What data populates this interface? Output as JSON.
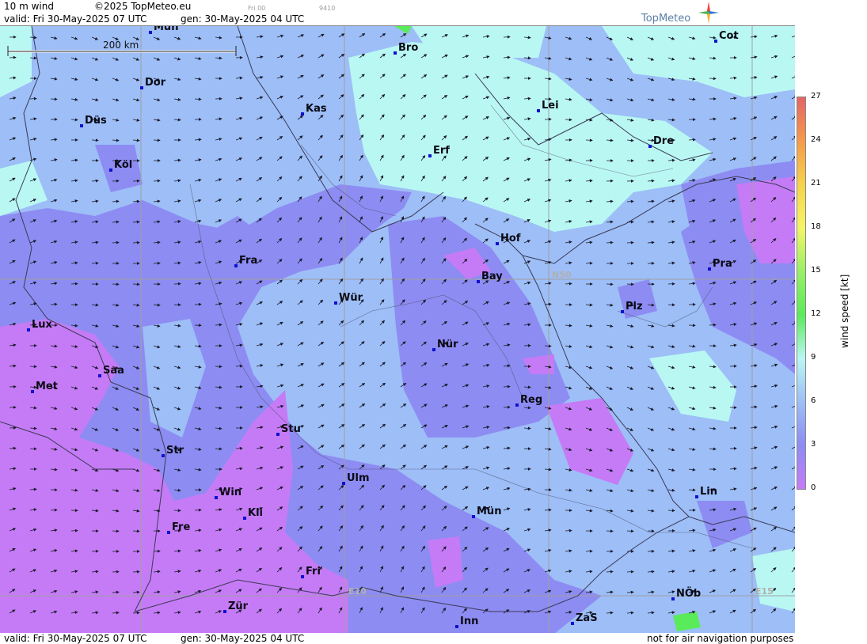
{
  "header": {
    "field": "10 m wind",
    "copyright": "©2025 TopMeteo.eu",
    "small_time": "Fri 00",
    "small_code": "9410",
    "valid": "valid:  Fri  30-May-2025  07 UTC",
    "gen": "gen: 30-May-2025 04 UTC",
    "logo": "TopMeteo"
  },
  "footer": {
    "valid": "valid:  Fri  30-May-2025  07 UTC",
    "gen": "gen: 30-May-2025 04 UTC",
    "disclaimer": "not for air navigation purposes"
  },
  "scale_bar": "200 km",
  "grid_labels": [
    "N50",
    "E10",
    "E15"
  ],
  "cities": [
    "Mün",
    "Bro",
    "Cot",
    "Dor",
    "Kas",
    "Lei",
    "Düs",
    "Erf",
    "Dre",
    "Köl",
    "Hof",
    "Pra",
    "Fra",
    "Bay",
    "Wür",
    "Plz",
    "Lux",
    "Nür",
    "Saa",
    "Met",
    "Reg",
    "Stu",
    "Str",
    "Ulm",
    "Lin",
    "Win",
    "Kli",
    "Mün",
    "Fre",
    "Fri",
    "NÖb",
    "Zür",
    "ZaS",
    "Inn"
  ],
  "legend": {
    "unit": "wind speed [kt]",
    "ticks": [
      "27",
      "24",
      "21",
      "18",
      "15",
      "12",
      "9",
      "6",
      "3",
      "0"
    ],
    "colors": [
      "#e56565",
      "#f59a4a",
      "#f6d24a",
      "#f5f566",
      "#98f066",
      "#5aeb5a",
      "#b9f7f3",
      "#9dbef7",
      "#8d8cf2",
      "#c57bf6"
    ]
  }
}
